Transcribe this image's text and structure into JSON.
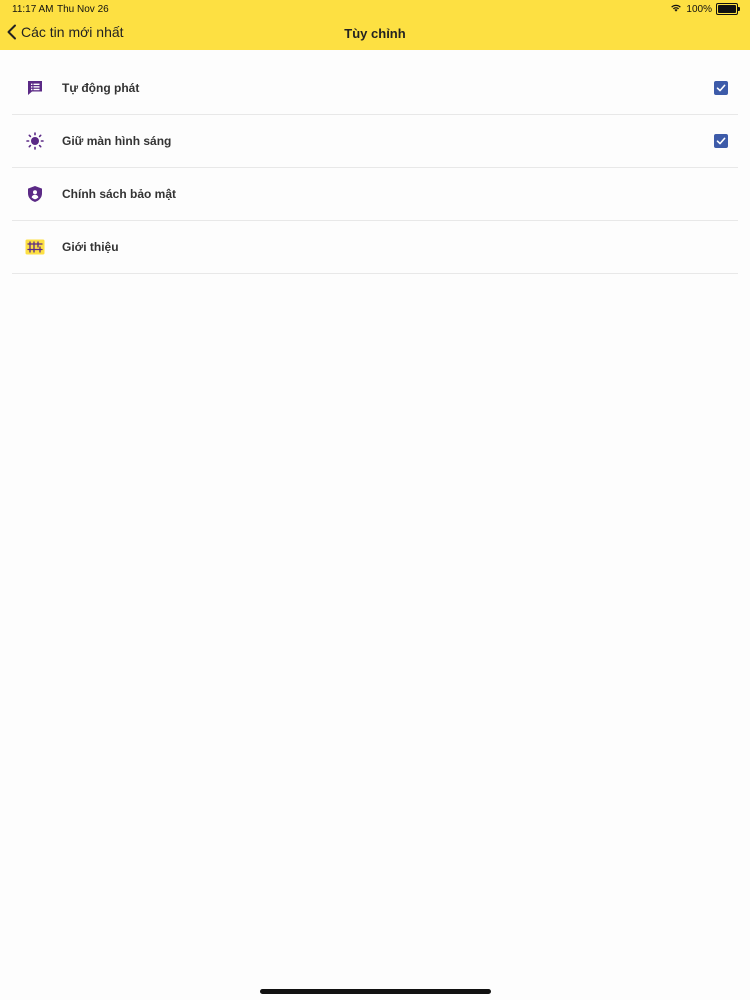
{
  "status_bar": {
    "time": "11:17 AM",
    "date": "Thu Nov 26",
    "battery": "100%",
    "wifi_icon": "wifi-icon",
    "battery_icon": "battery-icon"
  },
  "nav": {
    "back_label": "Các tin mới nhất",
    "title": "Tùy chỉnh"
  },
  "settings": {
    "items": [
      {
        "label": "Tự động phát",
        "icon": "autoplay-icon",
        "checked": true
      },
      {
        "label": "Giữ màn hình sáng",
        "icon": "brightness-icon",
        "checked": true
      },
      {
        "label": "Chính sách bảo mật",
        "icon": "privacy-shield-icon",
        "checked": null
      },
      {
        "label": "Giới thiệu",
        "icon": "about-logo-icon",
        "checked": null
      }
    ]
  },
  "colors": {
    "header": "#fde042",
    "icon_purple": "#5b2a86",
    "checkbox": "#3d5ba9"
  }
}
